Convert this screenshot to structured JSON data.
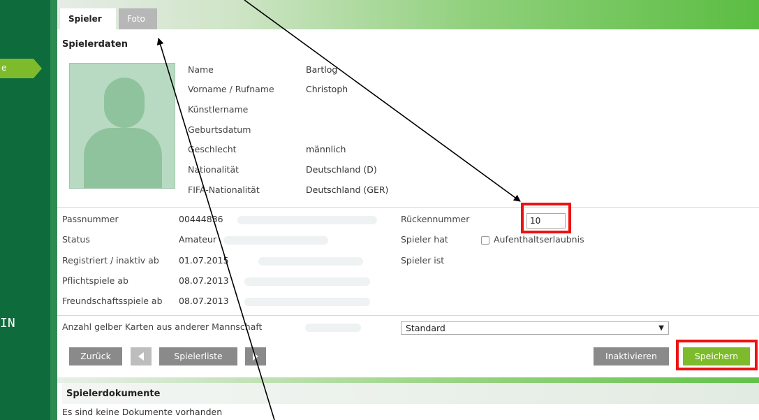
{
  "sidebar": {
    "active_item_fragment": "e",
    "bottom_fragment": "IN"
  },
  "tabs": [
    {
      "label": "Spieler"
    },
    {
      "label": "Foto"
    }
  ],
  "section": {
    "title": "Spielerdaten"
  },
  "personal": [
    {
      "label": "Name",
      "value": "Bartlog"
    },
    {
      "label": "Vorname / Rufname",
      "value": "Christoph"
    },
    {
      "label": "Künstlername",
      "value": ""
    },
    {
      "label": "Geburtsdatum",
      "value": ""
    },
    {
      "label": "Geschlecht",
      "value": "männlich"
    },
    {
      "label": "Nationalität",
      "value": "Deutschland (D)"
    },
    {
      "label": "FIFA-Nationalität",
      "value": "Deutschland (GER)"
    }
  ],
  "registration": [
    {
      "label": "Passnummer",
      "value": "00444836"
    },
    {
      "label": "Status",
      "value": "Amateur"
    },
    {
      "label": "Registriert / inaktiv ab",
      "value": "01.07.2015"
    },
    {
      "label": "Pflichtspiele ab",
      "value": "08.07.2013"
    },
    {
      "label": "Freundschaftsspiele ab",
      "value": "08.07.2013"
    }
  ],
  "right_fields": {
    "rueckennummer_label": "Rückennummer",
    "rueckennummer_value": "10",
    "spieler_hat_label": "Spieler hat",
    "aufenthalt_label": "Aufenthaltserlaubnis",
    "spieler_ist_label": "Spieler ist"
  },
  "cards": {
    "label": "Anzahl gelber Karten aus anderer Mannschaft",
    "selected": "Standard"
  },
  "buttons": {
    "back": "Zurück",
    "player_list": "Spielerliste",
    "deactivate": "Inaktivieren",
    "save": "Speichern"
  },
  "documents": {
    "title": "Spielerdokumente",
    "empty": "Es sind keine Dokumente vorhanden"
  },
  "colors": {
    "sidebar": "#0e6b3b",
    "accent_green": "#7dbb2c",
    "highlight_red": "#ee1111",
    "button_gray": "#8a8a8a"
  }
}
